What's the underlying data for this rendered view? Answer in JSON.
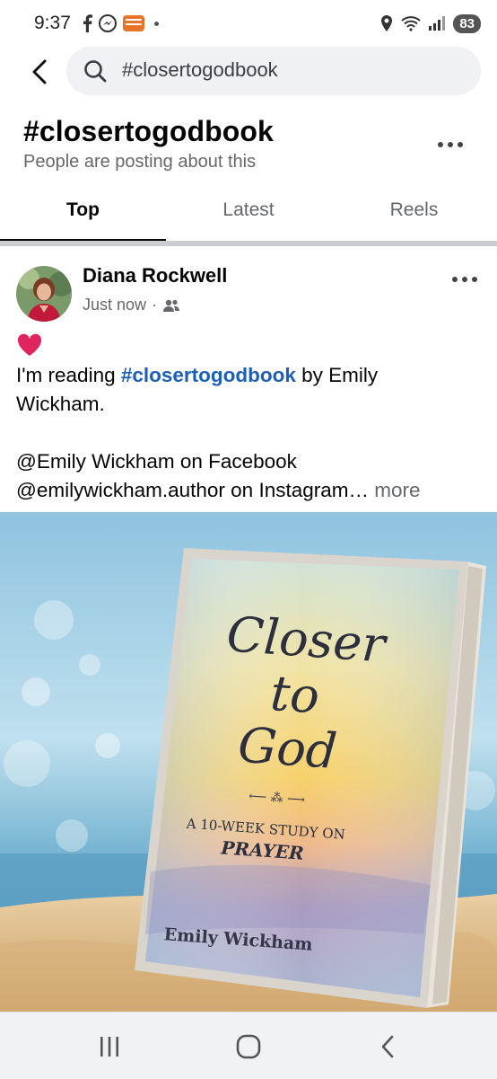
{
  "status_bar": {
    "time": "9:37",
    "battery": "83",
    "icons": [
      "facebook-icon",
      "messenger-icon",
      "app-badge-icon",
      "dot-icon",
      "location-icon",
      "wifi-icon",
      "signal-icon"
    ]
  },
  "search": {
    "query": "#closertogodbook"
  },
  "header": {
    "title": "#closertogodbook",
    "subtitle": "People are posting about this"
  },
  "tabs": [
    {
      "label": "Top",
      "active": true
    },
    {
      "label": "Latest",
      "active": false
    },
    {
      "label": "Reels",
      "active": false
    }
  ],
  "post": {
    "author": "Diana Rockwell",
    "time": "Just now",
    "text": {
      "line1_pre": "I'm reading ",
      "hashtag": "#closertogodbook",
      "line1_post": " by Emily",
      "line2": "Wickham.",
      "line3": "@Emily Wickham on Facebook",
      "line4": "@emilywickham.author on Instagram…",
      "more": "more"
    },
    "image": {
      "book_title_1": "Closer",
      "book_title_2": "to",
      "book_title_3": "God",
      "ornament": "⟵ ⁂ ⟶",
      "book_subtitle_1": "A 10-WEEK STUDY ON",
      "book_subtitle_2": "PRAYER",
      "book_author": "Emily Wickham"
    }
  },
  "colors": {
    "hashtag_blue": "#1b5fb8",
    "secondary_text": "#65676b",
    "search_bg": "#eff1f4",
    "heart_red": "#e0245e"
  }
}
